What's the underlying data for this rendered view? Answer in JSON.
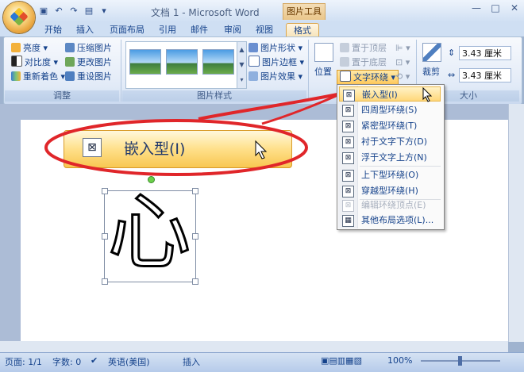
{
  "window": {
    "title": "文档 1 - Microsoft Word",
    "context_tab_group": "图片工具",
    "controls": [
      "—",
      "□",
      "✕"
    ]
  },
  "quick_access": {
    "save_icon": "save-icon",
    "undo": "↶",
    "redo": "↷"
  },
  "tabs": [
    "开始",
    "插入",
    "页面布局",
    "引用",
    "邮件",
    "审阅",
    "视图"
  ],
  "active_tab": "格式",
  "ribbon": {
    "adjust": {
      "label": "调整",
      "brightness": "亮度",
      "contrast": "对比度",
      "recolor": "重新着色",
      "compress": "压缩图片",
      "change": "更改图片",
      "reset": "重设图片"
    },
    "picture_styles": {
      "label": "图片样式",
      "shape": "图片形状",
      "border": "图片边框",
      "effects": "图片效果"
    },
    "arrange": {
      "position": "位置",
      "bring_front": "置于顶层",
      "send_back": "置于底层",
      "text_wrap": "文字环绕"
    },
    "size": {
      "label": "大小",
      "crop": "裁剪",
      "height": "3.43 厘米",
      "width": "3.43 厘米"
    }
  },
  "wrap_menu": {
    "items": [
      {
        "label": "嵌入型(I)",
        "highlighted": true,
        "disabled": false
      },
      {
        "label": "四周型环绕(S)",
        "disabled": false
      },
      {
        "label": "紧密型环绕(T)",
        "disabled": false
      },
      {
        "label": "衬于文字下方(D)",
        "disabled": false
      },
      {
        "label": "浮于文字上方(N)",
        "disabled": false
      },
      {
        "label": "上下型环绕(O)",
        "disabled": false
      },
      {
        "label": "穿越型环绕(H)",
        "disabled": false
      },
      {
        "label": "编辑环绕顶点(E)",
        "disabled": true
      },
      {
        "label": "其他布局选项(L)...",
        "disabled": false
      }
    ]
  },
  "callout": {
    "label": "嵌入型(I)"
  },
  "document": {
    "glyph": "心"
  },
  "statusbar": {
    "page": "页面: 1/1",
    "words": "字数: 0",
    "language": "英语(美国)",
    "mode": "插入",
    "zoom": "100%"
  },
  "colors": {
    "accent": "#15428b",
    "highlight": "#ffd77a",
    "callout_ring": "#e0262a"
  }
}
